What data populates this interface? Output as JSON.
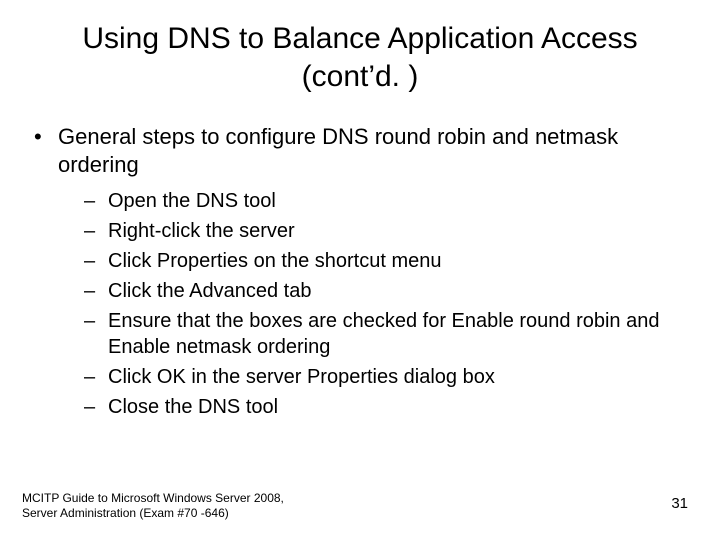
{
  "title": "Using DNS to Balance Application Access (cont’d. )",
  "bullets": {
    "main": "General steps to configure DNS round robin and netmask ordering",
    "subs": [
      "Open the DNS tool",
      "Right-click the server",
      "Click Properties on the shortcut menu",
      "Click the Advanced tab",
      "Ensure that the boxes are checked for Enable round robin and Enable netmask ordering",
      "Click OK in the server Properties dialog box",
      "Close the DNS tool"
    ]
  },
  "footer": {
    "line1": "MCITP Guide to Microsoft Windows Server 2008,",
    "line2": "Server Administration (Exam #70 -646)",
    "page": "31"
  }
}
